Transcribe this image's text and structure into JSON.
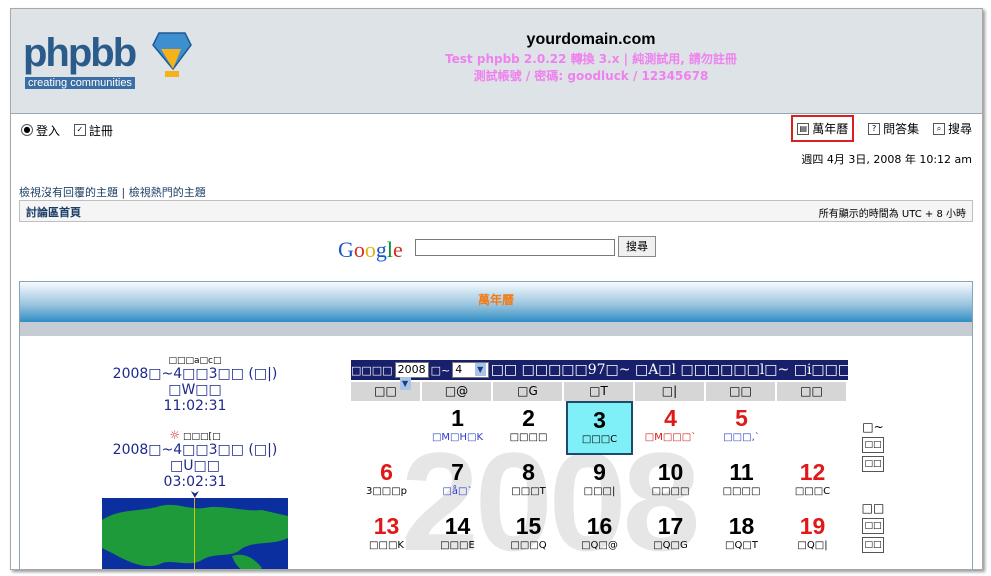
{
  "header": {
    "logo_text": "phpbb",
    "logo_sub": "creating communities",
    "site_title": "yourdomain.com",
    "desc_line1": "Test phpbb 2.0.22 轉換 3.x | 純測試用, 請勿註冊",
    "desc_line2": "測試帳號 / 密碼: goodluck / 12345678"
  },
  "toplinks": {
    "login": "登入",
    "register": "註冊",
    "calendar": "萬年曆",
    "faq": "問答集",
    "search": "搜尋"
  },
  "date_text": "週四 4月 3日, 2008 年 10:12 am",
  "links2": {
    "unanswered": "檢視沒有回覆的主題",
    "sep": " | ",
    "active": "檢視熱門的主題"
  },
  "nav": {
    "index": "討論區首頁",
    "timezone": "所有顯示的時間為 UTC + 8 小時"
  },
  "google": {
    "logo": "Google",
    "button": "搜尋",
    "input_value": ""
  },
  "panel": {
    "title": "萬年曆"
  },
  "clock1": {
    "label": "□□□a□c□",
    "date": "2008□~4□□3□□ (□|) □W□□",
    "time": "11:02:31"
  },
  "clock2": {
    "label": "□□□[□",
    "date": "2008□~4□□3□□ (□|) □U□□",
    "time": "03:02:31"
  },
  "calendar": {
    "prefix": "□□□□",
    "year": "2008",
    "mid": "□~",
    "month": "4",
    "suffix": "□□ □□□□□97□~ □A□l □□□□□□l□~ □i□□□j",
    "watermark": "2008",
    "weekdays": [
      "□□",
      "□@",
      "□G",
      "□T",
      "□|",
      "□□",
      "□□"
    ],
    "week1": [
      {
        "n": "",
        "l": ""
      },
      {
        "n": "1",
        "l": "□M□H□K"
      },
      {
        "n": "2",
        "l": "□□□□"
      },
      {
        "n": "3",
        "l": "□□□C"
      },
      {
        "n": "4",
        "l": "□M□□□`"
      },
      {
        "n": "5",
        "l": "□□□,`"
      }
    ],
    "week2": [
      {
        "n": "6",
        "l": "3□□□p"
      },
      {
        "n": "7",
        "l": "□å□`"
      },
      {
        "n": "8",
        "l": "□□□T"
      },
      {
        "n": "9",
        "l": "□□□|"
      },
      {
        "n": "10",
        "l": "□□□□"
      },
      {
        "n": "11",
        "l": "□□□□"
      },
      {
        "n": "12",
        "l": "□□□C"
      }
    ],
    "week3": [
      {
        "n": "13",
        "l": "□□□K"
      },
      {
        "n": "14",
        "l": "□□□E"
      },
      {
        "n": "15",
        "l": "□□□Q"
      },
      {
        "n": "16",
        "l": "□Q□@"
      },
      {
        "n": "17",
        "l": "□Q□G"
      },
      {
        "n": "18",
        "l": "□Q□T"
      },
      {
        "n": "19",
        "l": "□Q□|"
      }
    ],
    "side1_label": "□~",
    "side2_label": "□□",
    "side_btn": "□□"
  },
  "colors": {
    "header_bg": "#dee3e7",
    "link": "#1c3e66",
    "desc": "#ee82ee",
    "panel_title": "#f47a12",
    "holiday_red": "#e01818",
    "today_bg": "#7ff0f7",
    "calendar_bar": "#18206b"
  }
}
